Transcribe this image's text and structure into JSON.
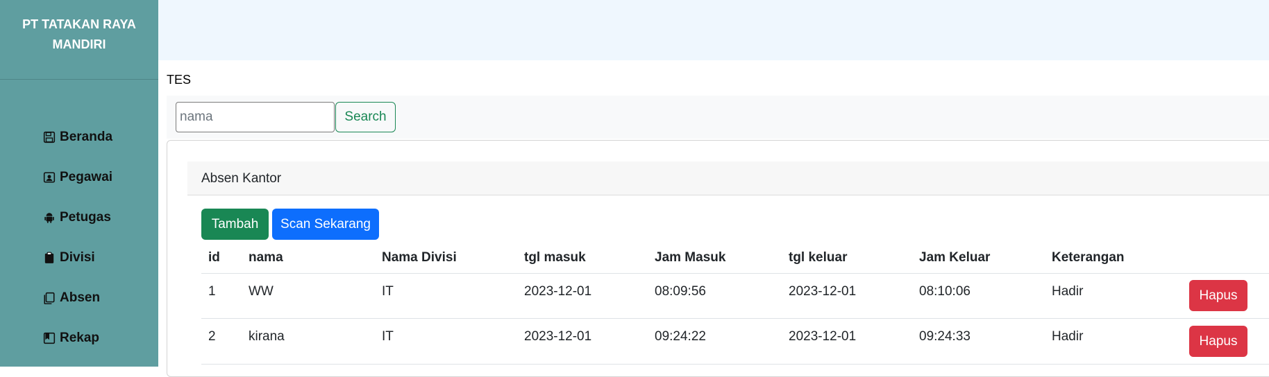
{
  "sidebar": {
    "brand_line1": "PT TATAKAN RAYA",
    "brand_line2": "MANDIRI",
    "items": [
      {
        "label": "Beranda",
        "icon": "floppy-disk-icon"
      },
      {
        "label": "Pegawai",
        "icon": "person-badge-icon"
      },
      {
        "label": "Petugas",
        "icon": "android-icon"
      },
      {
        "label": "Divisi",
        "icon": "clipboard-icon"
      },
      {
        "label": "Absen",
        "icon": "copy-icon"
      },
      {
        "label": "Rekap",
        "icon": "bookmark-icon"
      }
    ]
  },
  "page": {
    "title": "TES"
  },
  "search": {
    "placeholder": "nama",
    "value": "",
    "button_label": "Search"
  },
  "card": {
    "title": "Absen Kantor",
    "add_label": "Tambah",
    "scan_label": "Scan Sekarang",
    "columns": [
      "id",
      "nama",
      "Nama Divisi",
      "tgl masuk",
      "Jam Masuk",
      "tgl keluar",
      "Jam Keluar",
      "Keterangan"
    ],
    "rows": [
      {
        "id": "1",
        "nama": "WW",
        "divisi": "IT",
        "tgl_masuk": "2023-12-01",
        "jam_masuk": "08:09:56",
        "tgl_keluar": "2023-12-01",
        "jam_keluar": "08:10:06",
        "keterangan": "Hadir",
        "action": "Hapus"
      },
      {
        "id": "2",
        "nama": "kirana",
        "divisi": "IT",
        "tgl_masuk": "2023-12-01",
        "jam_masuk": "09:24:22",
        "tgl_keluar": "2023-12-01",
        "jam_keluar": "09:24:33",
        "keterangan": "Hadir",
        "action": "Hapus"
      }
    ]
  },
  "colors": {
    "sidebar": "#5f9ea0",
    "topbar": "#eff7fe",
    "success": "#198754",
    "primary": "#0d6efd",
    "danger": "#dc3545"
  }
}
